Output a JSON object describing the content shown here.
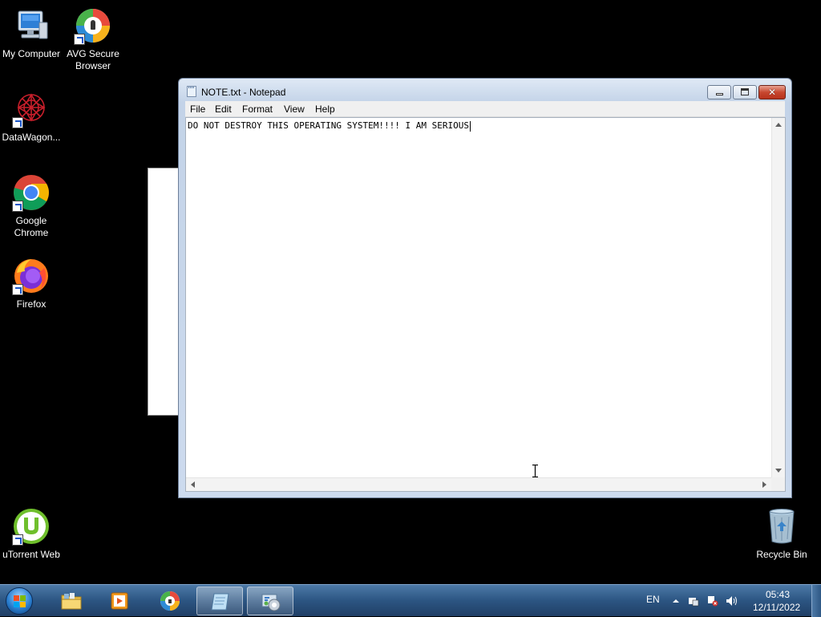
{
  "desktop": {
    "icons": [
      {
        "label_line1": "My Computer",
        "label_line2": "",
        "icon": "my-computer-icon"
      },
      {
        "label_line1": "AVG Secure",
        "label_line2": "Browser",
        "icon": "avg-secure-browser-icon"
      },
      {
        "label_line1": "DataWagon...",
        "label_line2": "",
        "icon": "datawagon-icon"
      },
      {
        "label_line1": "Google",
        "label_line2": "Chrome",
        "icon": "google-chrome-icon"
      },
      {
        "label_line1": "Firefox",
        "label_line2": "",
        "icon": "firefox-icon"
      },
      {
        "label_line1": "uTorrent Web",
        "label_line2": "",
        "icon": "utorrent-web-icon"
      },
      {
        "label_line1": "Recycle Bin",
        "label_line2": "",
        "icon": "recycle-bin-icon"
      }
    ]
  },
  "notepad": {
    "title": "NOTE.txt - Notepad",
    "menu": [
      "File",
      "Edit",
      "Format",
      "View",
      "Help"
    ],
    "content": "DO NOT DESTROY THIS OPERATING SYSTEM!!!! I AM SERIOUS"
  },
  "taskbar": {
    "apps": [
      {
        "name": "windows-explorer",
        "icon": "folder-icon",
        "active": false
      },
      {
        "name": "media-player",
        "icon": "media-player-icon",
        "active": false
      },
      {
        "name": "avg-browser",
        "icon": "avg-secure-browser-icon",
        "active": false
      },
      {
        "name": "notepad",
        "icon": "notepad-icon",
        "active": true
      },
      {
        "name": "control-panel",
        "icon": "control-panel-icon",
        "active": true
      }
    ],
    "language": "EN",
    "time": "05:43",
    "date": "12/11/2022"
  },
  "colors": {
    "desktop_bg": "#000000",
    "taskbar": "#2c5582",
    "close_button": "#c7472f"
  }
}
